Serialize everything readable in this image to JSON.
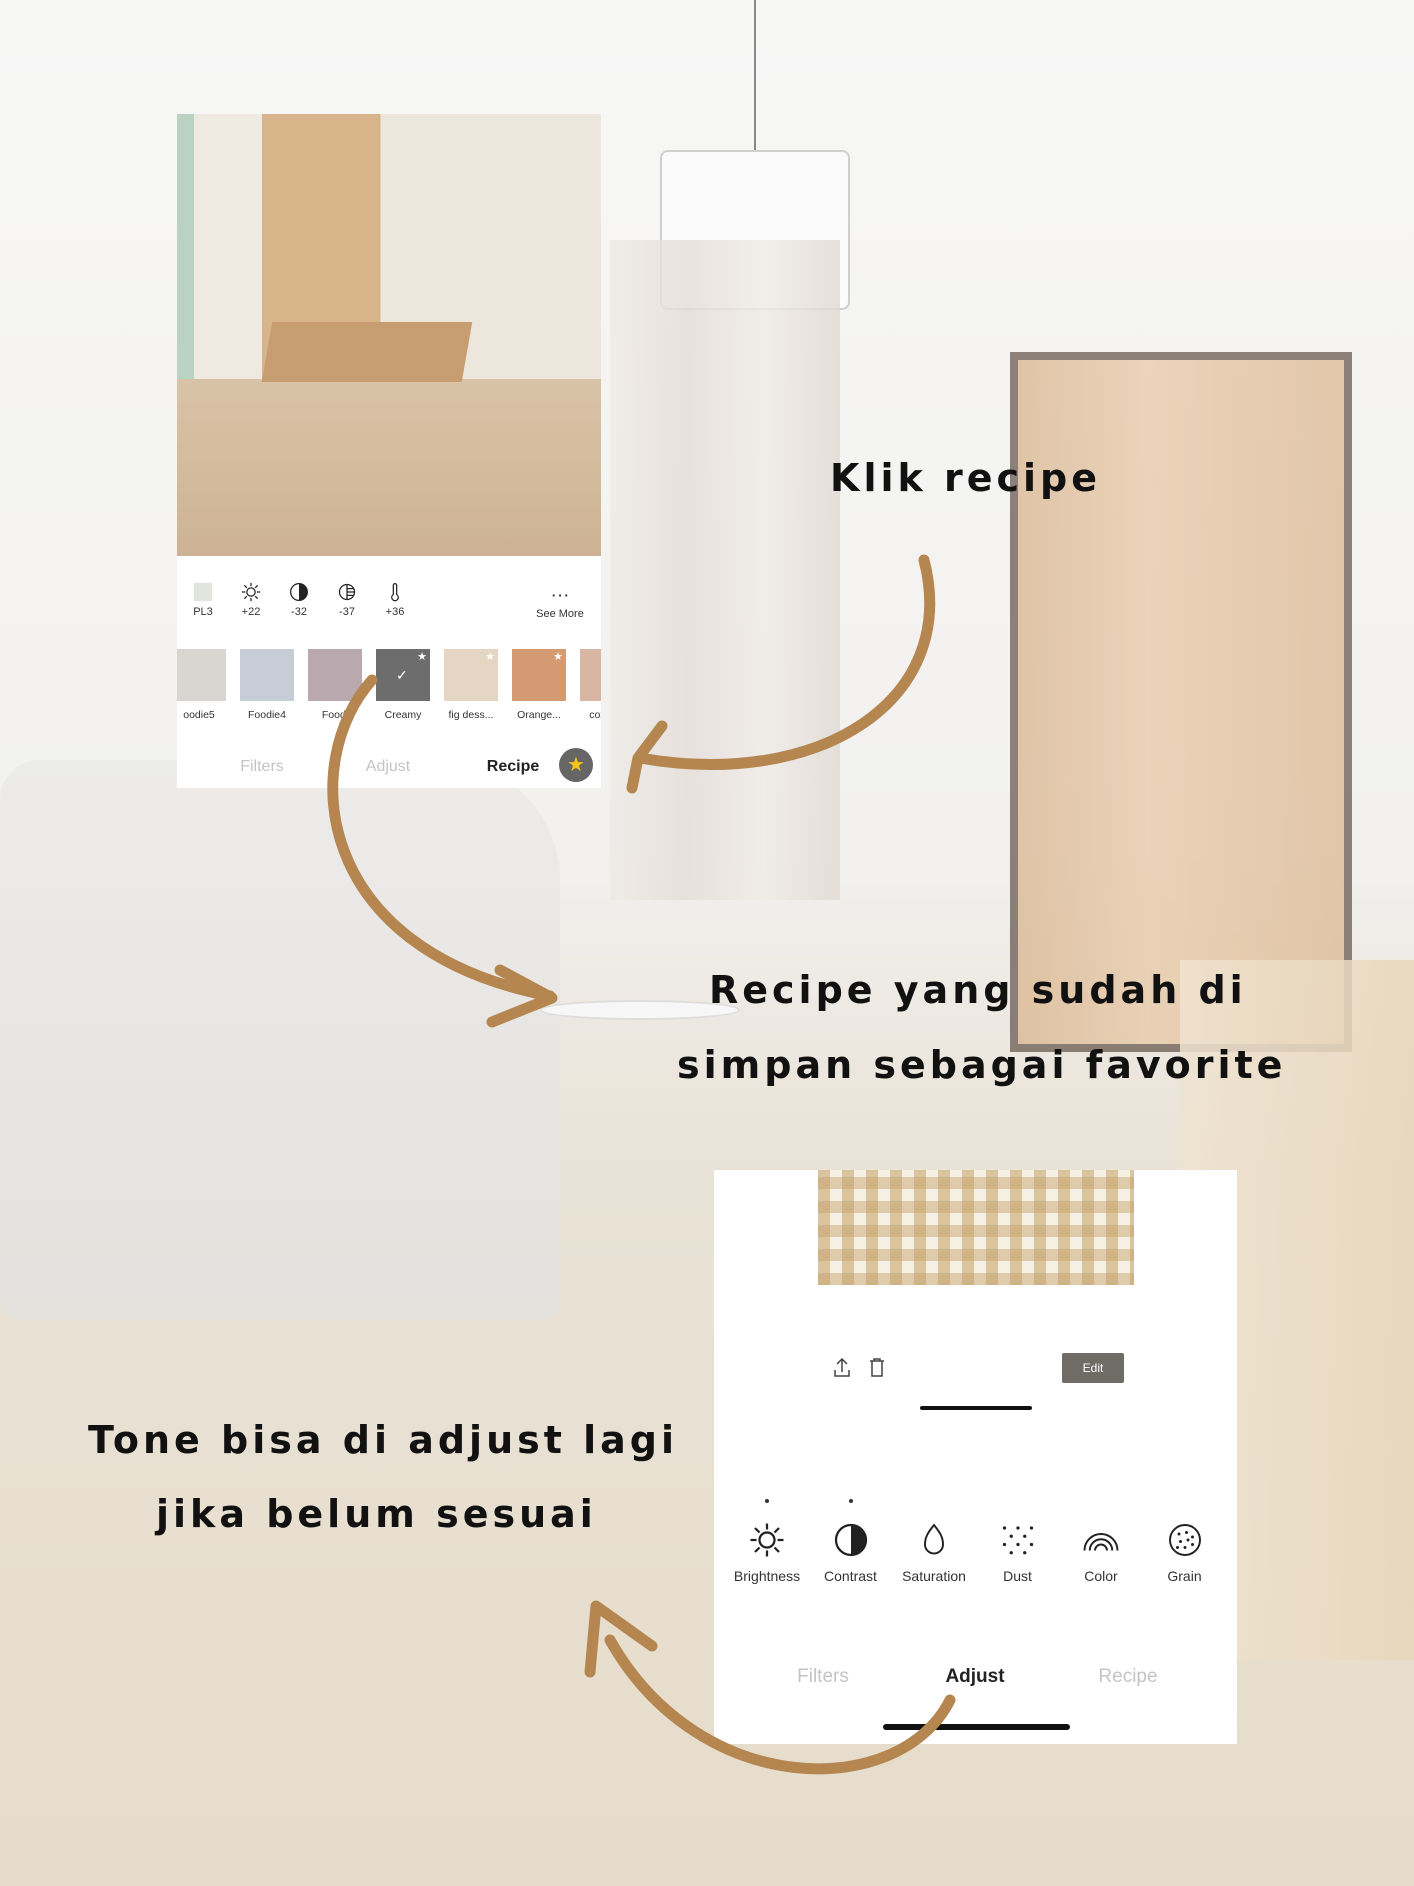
{
  "top_panel": {
    "toolbar": [
      {
        "icon": "preset-thumbnail-icon",
        "value": "PL3"
      },
      {
        "icon": "sun-icon",
        "value": "+22"
      },
      {
        "icon": "contrast-icon",
        "value": "-32"
      },
      {
        "icon": "highlights-icon",
        "value": "-37"
      },
      {
        "icon": "thermometer-icon",
        "value": "+36"
      }
    ],
    "see_more": "See More",
    "recipes": [
      {
        "label": "oodie5",
        "color": "#d8d6d0",
        "favorite": false,
        "selected": false
      },
      {
        "label": "Foodie4",
        "color": "#c7cdd6",
        "favorite": false,
        "selected": false
      },
      {
        "label": "Foodi",
        "color": "#b9a8ad",
        "favorite": false,
        "selected": false
      },
      {
        "label": "Creamy",
        "color": "#6d6d6d",
        "favorite": true,
        "selected": true
      },
      {
        "label": "fig dess...",
        "color": "#e5d6c3",
        "favorite": true,
        "selected": false
      },
      {
        "label": "Orange...",
        "color": "#d49a72",
        "favorite": true,
        "selected": false
      },
      {
        "label": "cozy ca",
        "color": "#d9b5a3",
        "favorite": false,
        "selected": false
      }
    ],
    "tabs": [
      "Filters",
      "Adjust",
      "Recipe"
    ],
    "active_tab": "Recipe"
  },
  "bottom_panel": {
    "edit_label": "Edit",
    "tools": [
      {
        "icon": "sun-icon",
        "label": "Brightness",
        "modified": true
      },
      {
        "icon": "contrast-icon",
        "label": "Contrast",
        "modified": true
      },
      {
        "icon": "drop-icon",
        "label": "Saturation",
        "modified": false
      },
      {
        "icon": "dust-icon",
        "label": "Dust",
        "modified": false
      },
      {
        "icon": "rainbow-icon",
        "label": "Color",
        "modified": false
      },
      {
        "icon": "grain-icon",
        "label": "Grain",
        "modified": false
      }
    ],
    "tabs": [
      "Filters",
      "Adjust",
      "Recipe"
    ],
    "active_tab": "Adjust"
  },
  "notes": {
    "klik": "Klik recipe",
    "fav1": "Recipe yang sudah di",
    "fav2": "simpan sebagai favorite",
    "tone1": "Tone bisa di adjust lagi",
    "tone2": "jika belum sesuai"
  },
  "colors": {
    "arrow": "#b5864f",
    "edit_button": "#6f6c66"
  }
}
